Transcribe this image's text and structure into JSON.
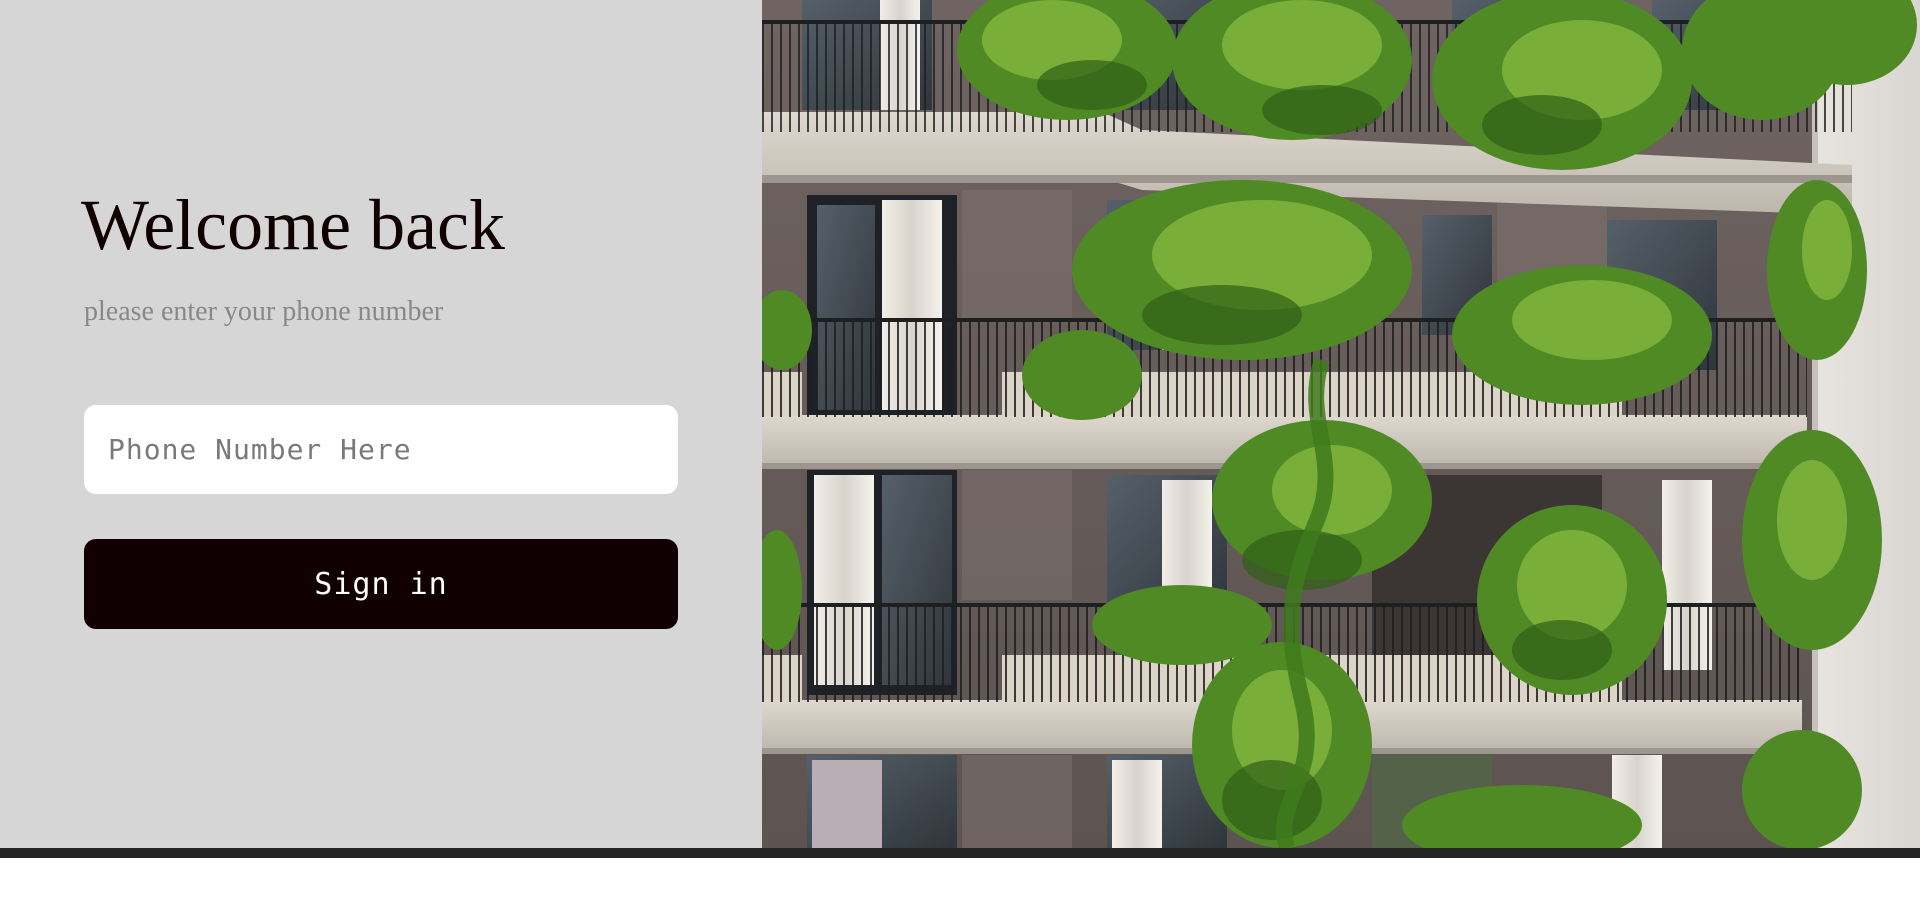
{
  "login": {
    "title": "Welcome back",
    "subtitle": "please enter your phone number",
    "phone_placeholder": "Phone Number Here",
    "phone_value": "",
    "submit_label": "Sign in"
  },
  "hero_image": {
    "subject": "building-facade-with-balcony-plants"
  },
  "colors": {
    "panel_background": "#d6d6d6",
    "title_text": "#100000",
    "subtitle_text": "#888888",
    "button_background": "#100003",
    "button_text": "#ffffff",
    "input_background": "#ffffff",
    "footer_bar": "#222426"
  }
}
